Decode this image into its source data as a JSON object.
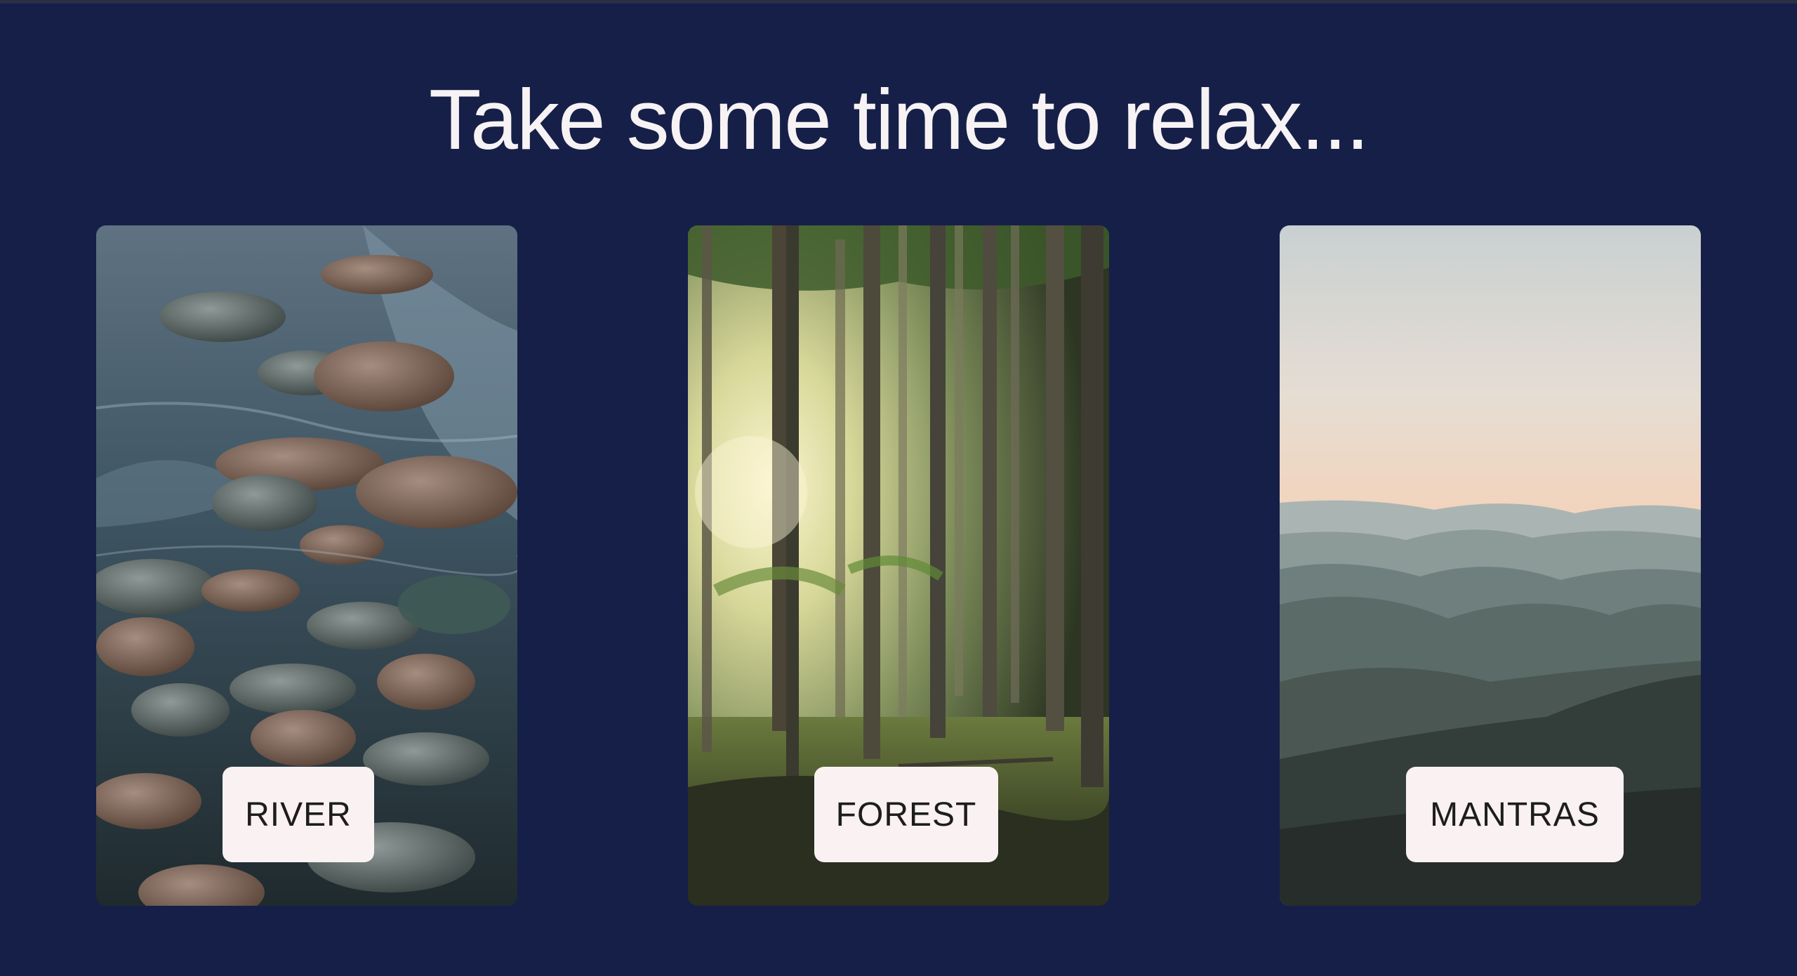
{
  "hero": {
    "title": "Take some time to relax..."
  },
  "cards": [
    {
      "label": "RIVER",
      "scene": "river-stones-photo"
    },
    {
      "label": "FOREST",
      "scene": "sunlit-forest-photo"
    },
    {
      "label": "MANTRAS",
      "scene": "misty-mountains-photo"
    }
  ],
  "colors": {
    "background": "#161f47",
    "title": "#f7f2f4",
    "button_bg": "#f9f1f2",
    "button_text": "#1d1d1d"
  }
}
